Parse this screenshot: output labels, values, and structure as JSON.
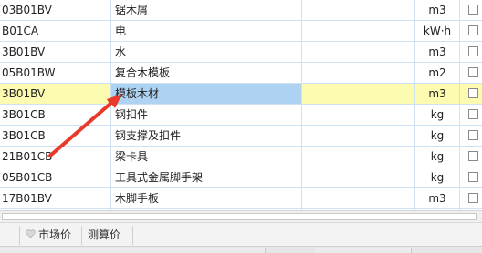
{
  "grid": {
    "rows": [
      {
        "code": "03B01BV",
        "name": "锯木屑",
        "unit": "m3",
        "selected": false
      },
      {
        "code": "B01CA",
        "name": "电",
        "unit": "kW·h",
        "selected": false
      },
      {
        "code": "3B01BV",
        "name": "水",
        "unit": "m3",
        "selected": false
      },
      {
        "code": "05B01BW",
        "name": "复合木模板",
        "unit": "m2",
        "selected": false
      },
      {
        "code": "3B01BV",
        "name": "模板木材",
        "unit": "m3",
        "selected": true
      },
      {
        "code": "3B01CB",
        "name": "钢扣件",
        "unit": "kg",
        "selected": false
      },
      {
        "code": "3B01CB",
        "name": "钢支撑及扣件",
        "unit": "kg",
        "selected": false
      },
      {
        "code": "21B01CB",
        "name": "梁卡具",
        "unit": "kg",
        "selected": false
      },
      {
        "code": "05B01CB",
        "name": "工具式金属脚手架",
        "unit": "kg",
        "selected": false
      },
      {
        "code": "17B01BV",
        "name": "木脚手板",
        "unit": "m3",
        "selected": false
      }
    ]
  },
  "tabs": [
    {
      "label": "",
      "icon": "tab-left-partial"
    },
    {
      "label": "市场价",
      "icon": "heart-icon"
    },
    {
      "label": "测算价",
      "icon": ""
    }
  ],
  "colors": {
    "selected_row": "#fdfbb0",
    "selected_cell": "#aed2f2",
    "grid_line": "#cfe2f3",
    "annotation_arrow": "#e8392b"
  }
}
